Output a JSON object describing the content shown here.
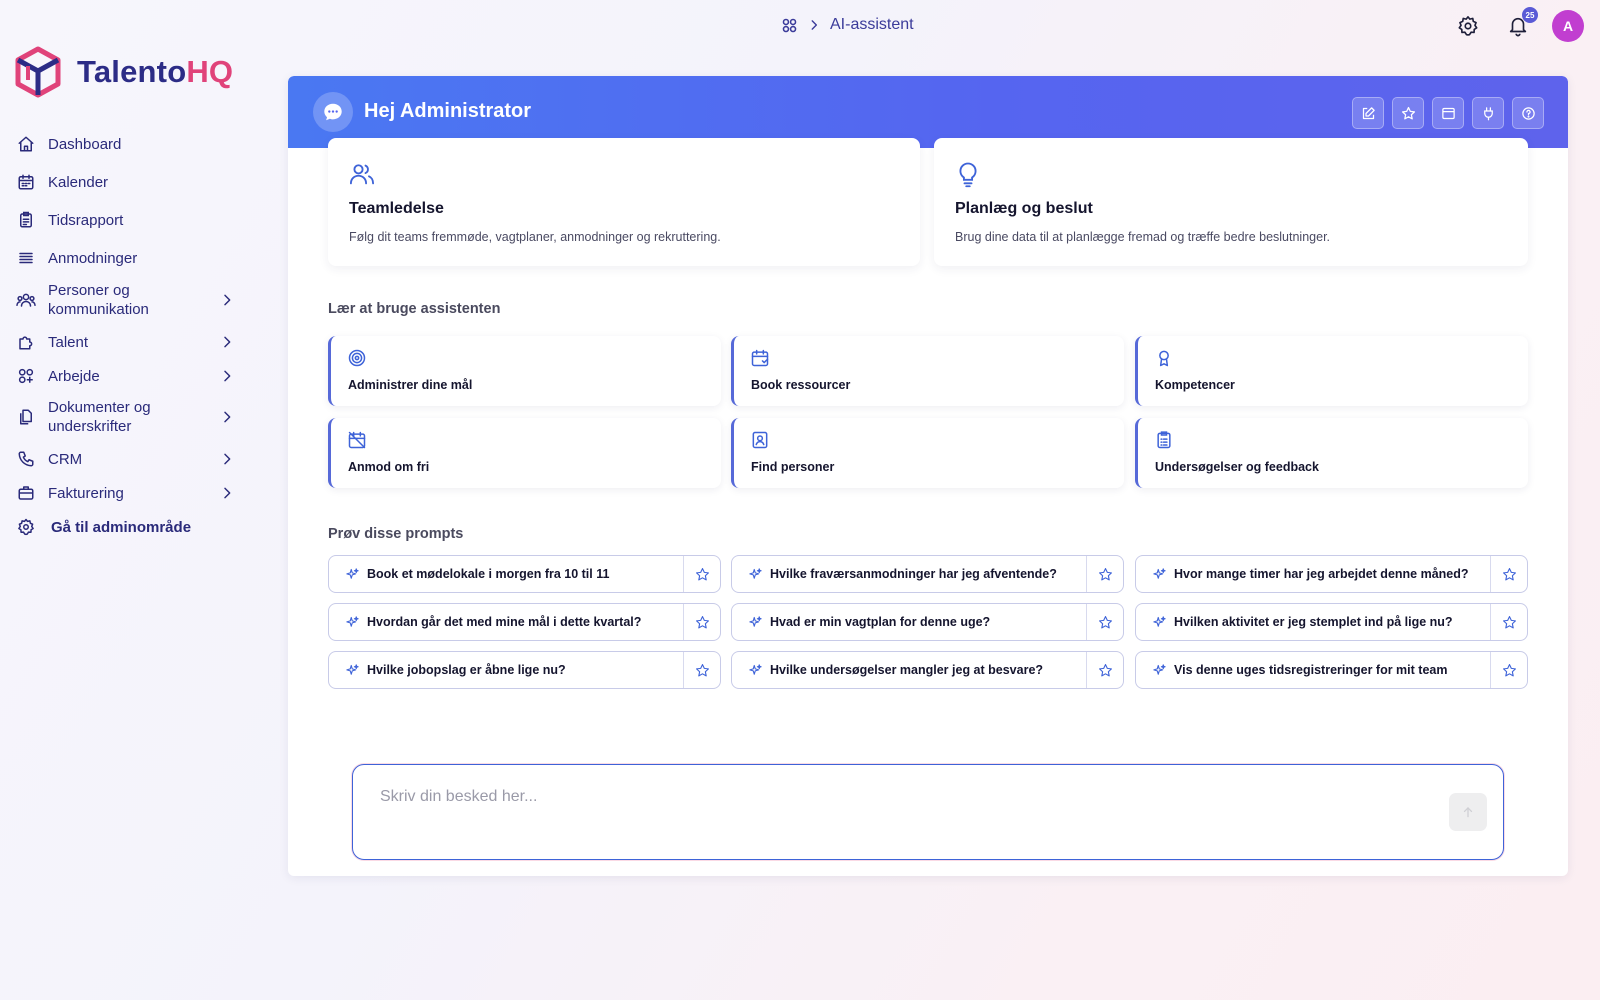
{
  "brand": {
    "name_part1": "Talento",
    "name_part2": "HQ",
    "primary": "#2c2c86",
    "accent": "#e0437a"
  },
  "breadcrumb": {
    "icon": "grid-icon",
    "current": "AI-assistent"
  },
  "topbar": {
    "notification_count": "25",
    "avatar_initial": "A"
  },
  "sidebar": {
    "items": [
      {
        "label": "Dashboard",
        "icon": "home-icon"
      },
      {
        "label": "Kalender",
        "icon": "calendar-icon"
      },
      {
        "label": "Tidsrapport",
        "icon": "timesheet-icon"
      },
      {
        "label": "Anmodninger",
        "icon": "list-icon"
      },
      {
        "label": "Personer og kommunikation",
        "icon": "people-icon"
      },
      {
        "label": "Talent",
        "icon": "puzzle-icon"
      },
      {
        "label": "Arbejde",
        "icon": "apps-icon"
      },
      {
        "label": "Dokumenter og underskrifter",
        "icon": "documents-icon"
      },
      {
        "label": "CRM",
        "icon": "phone-icon"
      },
      {
        "label": "Fakturering",
        "icon": "briefcase-icon"
      },
      {
        "label": "Gå til adminområde",
        "icon": "gear-icon"
      }
    ]
  },
  "assistant": {
    "greeting": "Hej Administrator",
    "header_tools": [
      "edit-icon",
      "star-icon",
      "window-icon",
      "plug-icon",
      "help-icon"
    ],
    "features": [
      {
        "title": "Teamledelse",
        "description": "Følg dit teams fremmøde, vagtplaner, anmodninger og rekruttering.",
        "icon": "team-icon"
      },
      {
        "title": "Planlæg og beslut",
        "description": "Brug dine data til at planlægge fremad og træffe bedre beslutninger.",
        "icon": "lightbulb-icon"
      }
    ],
    "learn_title": "Lær at bruge assistenten",
    "learn_items": [
      {
        "label": "Administrer dine mål",
        "icon": "target-icon"
      },
      {
        "label": "Book ressourcer",
        "icon": "calendar-check-icon"
      },
      {
        "label": "Kompetencer",
        "icon": "award-icon"
      },
      {
        "label": "Anmod om fri",
        "icon": "calendar-off-icon"
      },
      {
        "label": "Find personer",
        "icon": "contact-icon"
      },
      {
        "label": "Undersøgelser og feedback",
        "icon": "survey-icon"
      }
    ],
    "prompts_title": "Prøv disse prompts",
    "prompts": [
      "Book et mødelokale i morgen fra 10 til 11",
      "Hvilke fraværsanmodninger har jeg afventende?",
      "Hvor mange timer har jeg arbejdet denne måned?",
      "Hvordan går det med mine mål i dette kvartal?",
      "Hvad er min vagtplan for denne uge?",
      "Hvilken aktivitet er jeg stemplet ind på lige nu?",
      "Hvilke jobopslag er åbne lige nu?",
      "Hvilke undersøgelser mangler jeg at besvare?",
      "Vis denne uges tidsregistreringer for mit team"
    ],
    "composer": {
      "placeholder": "Skriv din besked her...",
      "value": ""
    }
  }
}
